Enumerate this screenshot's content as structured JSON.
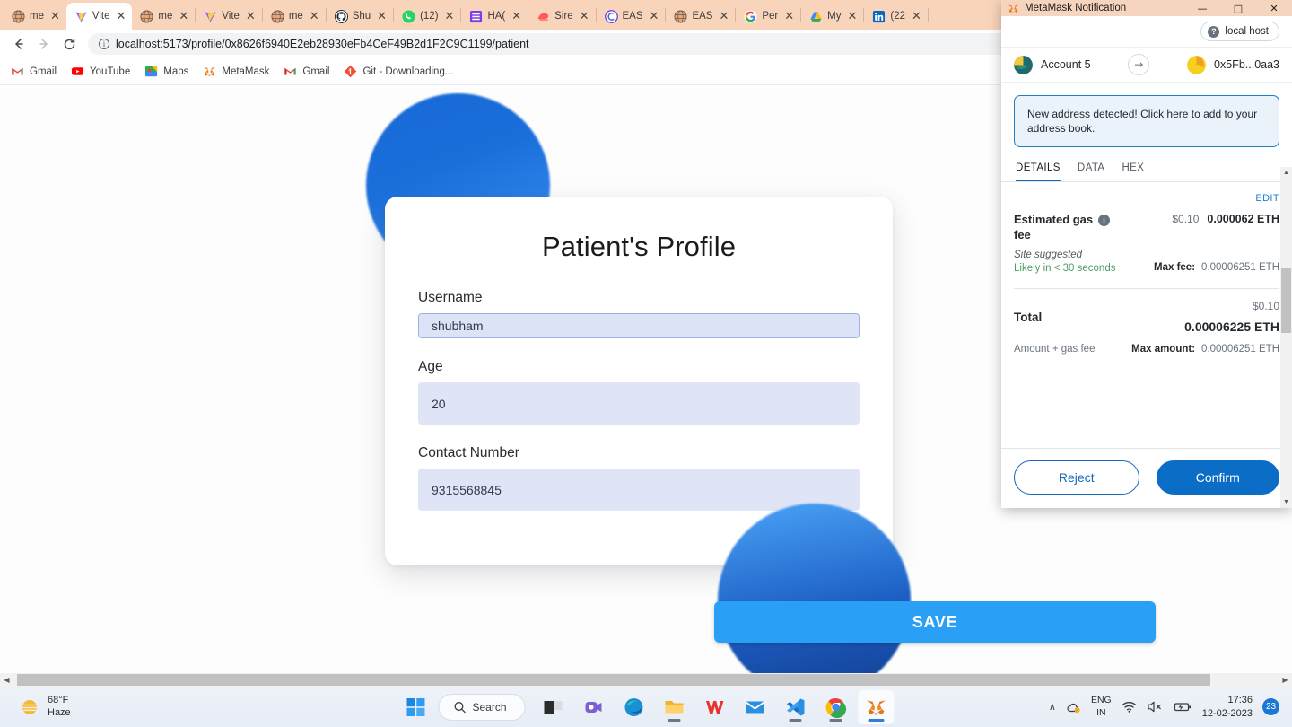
{
  "browser": {
    "tabs": [
      {
        "title": "me",
        "icon": "globe-icon",
        "active": false
      },
      {
        "title": "Vite",
        "icon": "vite-icon",
        "active": true
      },
      {
        "title": "me",
        "icon": "globe-icon",
        "active": false
      },
      {
        "title": "Vite",
        "icon": "vite-icon",
        "active": false
      },
      {
        "title": "me",
        "icon": "globe-icon",
        "active": false
      },
      {
        "title": "Shu",
        "icon": "github-icon",
        "active": false
      },
      {
        "title": "(12)",
        "icon": "whatsapp-icon",
        "active": false
      },
      {
        "title": "HA(",
        "icon": "notion-icon",
        "active": false
      },
      {
        "title": "Sire",
        "icon": "siren-icon",
        "active": false
      },
      {
        "title": "EAS",
        "icon": "eas-icon",
        "active": false
      },
      {
        "title": "EAS",
        "icon": "globe-icon",
        "active": false
      },
      {
        "title": "Per",
        "icon": "google-icon",
        "active": false
      },
      {
        "title": "My",
        "icon": "drive-icon",
        "active": false
      },
      {
        "title": "(22",
        "icon": "linkedin-icon",
        "active": false
      }
    ],
    "nav": {
      "back_label": "←",
      "forward_label": "→",
      "reload_label": "↻"
    },
    "omnibox": {
      "url": "localhost:5173/profile/0x8626f6940E2eb28930eFb4CeF49B2d1F2C9C1199/patient",
      "info_glyph": "i",
      "placeholder": "Search Google or type a URL"
    },
    "bookmarks": [
      {
        "label": "Gmail",
        "icon": "gmail-icon"
      },
      {
        "label": "YouTube",
        "icon": "youtube-icon"
      },
      {
        "label": "Maps",
        "icon": "maps-icon"
      },
      {
        "label": "MetaMask",
        "icon": "metamask-icon"
      },
      {
        "label": "Gmail",
        "icon": "gmail-icon"
      },
      {
        "label": "Git - Downloading...",
        "icon": "git-icon"
      }
    ]
  },
  "profile_form": {
    "title": "Patient's Profile",
    "fields": [
      {
        "label": "Username",
        "value": "shubham",
        "placeholder": "Username",
        "focused": true
      },
      {
        "label": "Age",
        "value": "20",
        "placeholder": "Age",
        "focused": false
      },
      {
        "label": "Contact Number",
        "value": "9315568845",
        "placeholder": "Contact Number",
        "focused": false
      }
    ],
    "save_label": "SAVE",
    "accent_color": "#29a0f5",
    "field_bg_color": "#dfe4f7"
  },
  "metamask": {
    "window_title": "MetaMask Notification",
    "window_controls": {
      "minimize": "—",
      "maximize": "□",
      "close": "✕"
    },
    "network": {
      "label": "local host",
      "badge_glyph": "?"
    },
    "from_account": "Account 5",
    "to_account": "0x5Fb...0aa3",
    "transfer_arrow": "→",
    "banner": "New address detected! Click here to add to your address book.",
    "tabs": [
      {
        "label": "DETAILS",
        "active": true
      },
      {
        "label": "DATA",
        "active": false
      },
      {
        "label": "HEX",
        "active": false
      }
    ],
    "edit_label": "EDIT",
    "gas": {
      "label": "Estimated gas fee",
      "info_glyph": "i",
      "fiat": "$0.10",
      "eth": "0.000062 ETH",
      "site_suggested": "Site suggested",
      "likely": "Likely in < 30 seconds",
      "max_fee_label": "Max fee:",
      "max_fee_value": "0.00006251 ETH"
    },
    "total": {
      "label": "Total",
      "fiat": "$0.10",
      "eth": "0.00006225 ETH",
      "amount_label": "Amount + gas fee",
      "max_amount_label": "Max amount:",
      "max_amount_value": "0.00006251 ETH"
    },
    "reject_label": "Reject",
    "confirm_label": "Confirm",
    "confirm_color": "#0c6dc7"
  },
  "taskbar": {
    "weather": {
      "temp": "68°F",
      "condition": "Haze",
      "icon": "haze-sun-icon"
    },
    "start_label": "start-icon",
    "search_label": "Search",
    "apps": [
      {
        "name": "task-view-icon",
        "running": false
      },
      {
        "name": "teams-icon",
        "running": false
      },
      {
        "name": "edge-icon",
        "running": false
      },
      {
        "name": "file-explorer-icon",
        "running": true
      },
      {
        "name": "wps-office-icon",
        "running": false
      },
      {
        "name": "mail-icon",
        "running": false
      },
      {
        "name": "vscode-icon",
        "running": true
      },
      {
        "name": "chrome-icon",
        "running": true
      },
      {
        "name": "metamask-icon",
        "running": true
      }
    ],
    "tray": {
      "chevron": "∧",
      "language": "ENG",
      "region": "IN",
      "wifi_icon": "wifi-icon",
      "volume_icon": "volume-muted-icon",
      "battery_icon": "battery-charging-icon",
      "time": "17:36",
      "date": "12-02-2023",
      "notification_count": "23"
    }
  }
}
